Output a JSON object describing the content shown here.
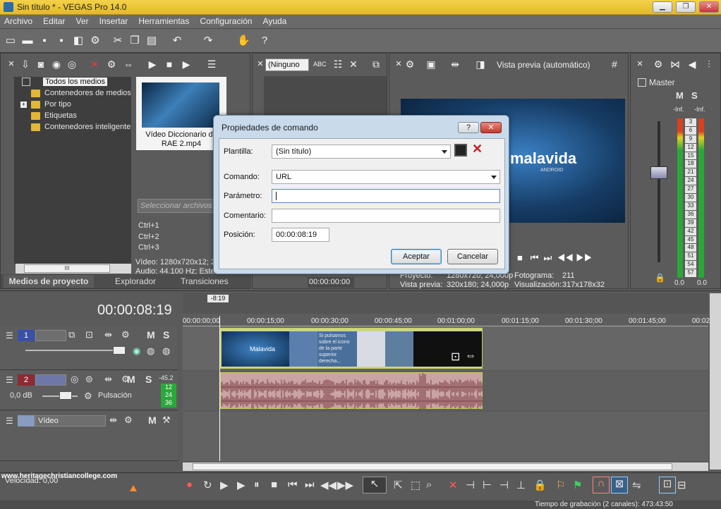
{
  "window": {
    "title": "Sin título * - VEGAS Pro 14.0",
    "btn_min": "▁",
    "btn_max": "❐",
    "btn_close": "✕"
  },
  "menu": [
    "Archivo",
    "Editar",
    "Ver",
    "Insertar",
    "Herramientas",
    "Configuración",
    "Ayuda"
  ],
  "media_panel": {
    "tree": [
      "Todos los medios",
      "Contenedores de medios",
      "Por tipo",
      "Etiquetas",
      "Contenedores inteligente"
    ],
    "thumb_label": "Vídeo Diccionario de RAE 2.mp4",
    "search_placeholder": "Seleccionar archivos",
    "shortcuts": [
      "Ctrl+1",
      "Ctrl+2",
      "Ctrl+3"
    ],
    "info_video": "Vídeo: 1280x720x12; 2",
    "info_audio": "Audio: 44.100 Hz; Este",
    "tabs": [
      "Medios de proyecto",
      "Explorador",
      "Transiciones"
    ],
    "expander": "+",
    "scroll_handle": "III"
  },
  "fx_panel": {
    "select_value": "(Ninguno",
    "timecode": "00:00:00:00"
  },
  "preview": {
    "mode": "Vista previa (automático)",
    "brand": "malavida",
    "sub": "ANDROID",
    "proyecto": "Proyecto:",
    "proyecto_val": "1280x720; 24,000p",
    "vista_previa": "Vista previa:",
    "vista_previa_val": "320x180; 24,000p",
    "fotograma": "Fotograma:",
    "fotograma_val": "211",
    "visualizacion": "Visualización:",
    "visualizacion_val": "317x178x32"
  },
  "master": {
    "label": "Master",
    "left_lbl": "-Inf.",
    "right_lbl": "-Inf.",
    "scale": [
      "3",
      "6",
      "9",
      "12",
      "15",
      "18",
      "21",
      "24",
      "27",
      "30",
      "33",
      "36",
      "39",
      "42",
      "45",
      "48",
      "51",
      "54",
      "57"
    ],
    "bottom_left": "0.0",
    "bottom_right": "0.0",
    "mute": "M",
    "solo": "S"
  },
  "dialog": {
    "title": "Propiedades de comando",
    "help_btn": "?",
    "close_btn": "✕",
    "plantilla_label": "Plantilla:",
    "plantilla_value": "(Sin título)",
    "comando_label": "Comando:",
    "comando_value": "URL",
    "parametro_label": "Parámetro:",
    "parametro_value": "",
    "comentario_label": "Comentario:",
    "comentario_value": "",
    "posicion_label": "Posición:",
    "posicion_value": "00:00:08:19",
    "accept": "Aceptar",
    "cancel": "Cancelar"
  },
  "timeline": {
    "cursor_time": "00:00:08:19",
    "marker": "-8:19",
    "ruler": [
      "00:00:00;00",
      "00:00:15;00",
      "00:00:30;00",
      "00:00:45;00",
      "00:01:00;00",
      "00:01:15;00",
      "00:01:30;00",
      "00:01:45;00",
      "00:02"
    ],
    "track1_num": "1",
    "track2_num": "2",
    "track2_db": "0,0 dB",
    "track2_mode": "Pulsación",
    "track2_meter": [
      "-45.2",
      "12",
      "24",
      "36"
    ],
    "track3_name": "Vídeo",
    "clip_brand": "Malavida",
    "clip_text": "Si pulsamos sobre el icono de la parte superior derecha...",
    "mute": "M",
    "solo": "S"
  },
  "status": {
    "velocidad": "Velocidad: 0,00",
    "watermark": "www.heritagechristiancollege.com",
    "grabacion": "Tiempo de grabación (2 canales): 473:43:50"
  }
}
